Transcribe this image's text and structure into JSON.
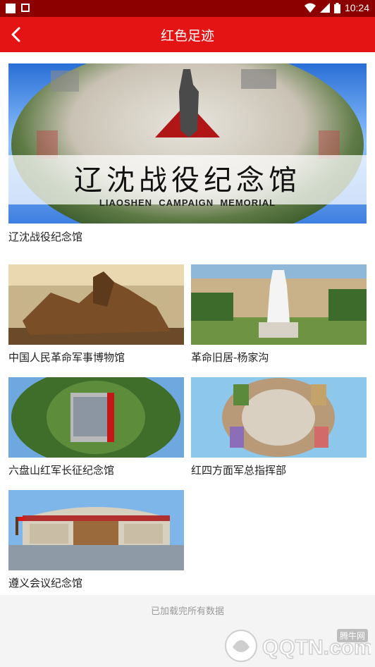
{
  "status_bar": {
    "time": "10:24",
    "icons": [
      "notification-square-icon",
      "notification-a-icon",
      "wifi-icon",
      "cell-signal-icon",
      "battery-icon"
    ]
  },
  "app_bar": {
    "title": "红色足迹",
    "back_icon": "chevron-left-icon"
  },
  "featured": {
    "caption": "辽沈战役纪念馆",
    "banner_cn": "辽沈战役纪念馆",
    "banner_en": "LIAOSHEN  CAMPAIGN  MEMORIAL"
  },
  "items": [
    {
      "caption": "中国人民革命军事博物馆"
    },
    {
      "caption": "革命旧居-杨家沟"
    },
    {
      "caption": "六盘山红军长征纪念馆"
    },
    {
      "caption": "红四方面军总指挥部"
    },
    {
      "caption": "遵义会议纪念馆"
    }
  ],
  "footer": {
    "load_message": "已加载完所有数据"
  },
  "watermark": {
    "text": "QQTN.com",
    "tag": "腾牛网"
  },
  "colors": {
    "status_bar": "#8c0000",
    "app_bar": "#e41414",
    "footer_bg": "#f4f4f4"
  }
}
